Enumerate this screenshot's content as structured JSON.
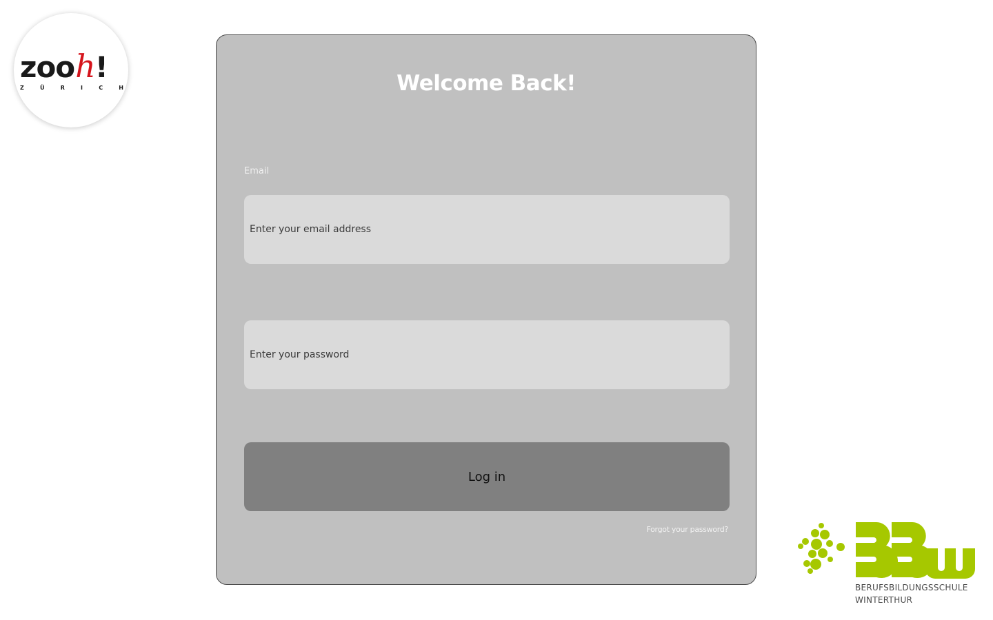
{
  "zoo_logo": {
    "wordmark": "zoo",
    "wordmark_h": "h",
    "wordmark_bang": "!",
    "city": "ZÜRICH",
    "brand_color": "#d5141c"
  },
  "login": {
    "title": "Welcome Back!",
    "email_label": "Email",
    "email_placeholder": "Enter your email address",
    "password_placeholder": "Enter your password",
    "login_button": "Log in",
    "forgot_password": "Forgot your password?"
  },
  "bbw_logo": {
    "letters": "BBW",
    "line1": "BERUFSBILDUNGSSCHULE",
    "line2": "WINTERTHUR",
    "brand_color": "#a6c800"
  },
  "colors": {
    "card_background": "#c0c0c0",
    "input_background": "#dadada",
    "button_background": "#808080"
  }
}
